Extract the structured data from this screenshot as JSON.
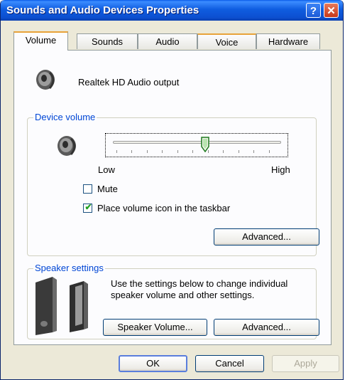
{
  "window": {
    "title": "Sounds and Audio Devices Properties",
    "help_icon": "?",
    "close_icon": "✕"
  },
  "tabs": [
    {
      "label": "Volume"
    },
    {
      "label": "Sounds"
    },
    {
      "label": "Audio"
    },
    {
      "label": "Voice"
    },
    {
      "label": "Hardware"
    }
  ],
  "device": {
    "name": "Realtek HD Audio output"
  },
  "device_volume": {
    "group_label": "Device volume",
    "low_label": "Low",
    "high_label": "High",
    "level": 0.55,
    "mute_label": "Mute",
    "mute_checked": false,
    "place_icon_label": "Place volume icon in the taskbar",
    "place_icon_checked": true,
    "check_glyph": "✔",
    "advanced_label": "Advanced..."
  },
  "speaker_settings": {
    "group_label": "Speaker settings",
    "description_line1": "Use the settings below to change individual",
    "description_line2": "speaker volume and other settings.",
    "speaker_volume_label": "Speaker Volume...",
    "advanced_label": "Advanced..."
  },
  "footer": {
    "ok_label": "OK",
    "cancel_label": "Cancel",
    "apply_label": "Apply"
  },
  "colors": {
    "titlebar": "#0c4fd0",
    "accent_tab": "#e8a33a",
    "group_label": "#0046d5"
  }
}
